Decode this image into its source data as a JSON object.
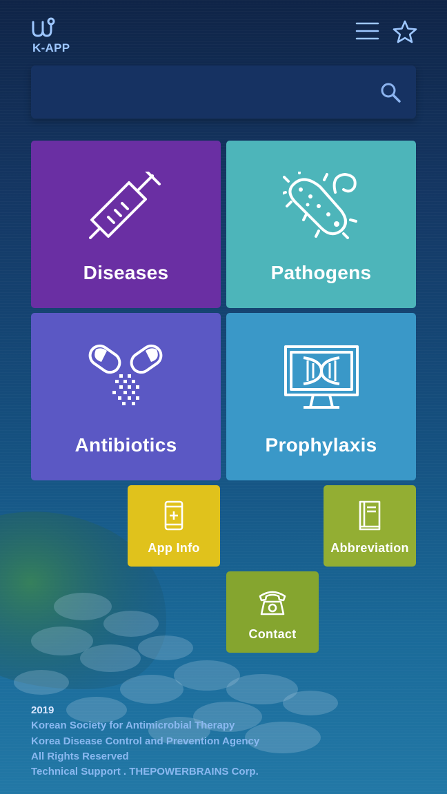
{
  "app": {
    "logo_text": "K-APP"
  },
  "header": {
    "menu_icon": "hamburger-menu-icon",
    "favorite_icon": "star-icon"
  },
  "search": {
    "placeholder": "",
    "value": "",
    "icon": "search-icon"
  },
  "tiles": [
    {
      "label": "Diseases",
      "icon": "syringe-icon",
      "color": "#6a2fa3"
    },
    {
      "label": "Pathogens",
      "icon": "bacteria-icon",
      "color": "#4db5ba"
    },
    {
      "label": "Antibiotics",
      "icon": "pills-icon",
      "color": "#5b58c4"
    },
    {
      "label": "Prophylaxis",
      "icon": "dna-monitor-icon",
      "color": "#3a98c8"
    }
  ],
  "small_tiles": [
    {
      "label": "App Info",
      "icon": "phone-icon",
      "color": "#e0c21c"
    },
    {
      "label": "Abbreviation",
      "icon": "book-icon",
      "color": "#93ae33"
    },
    {
      "label": "Contact",
      "icon": "telephone-icon",
      "color": "#85a52f"
    }
  ],
  "footer": {
    "year": "2019",
    "line1": "Korean Society for Antimicrobial Therapy",
    "line2": "Korea Disease Control and Prevention Agency",
    "line3": "All Rights Reserved",
    "line4": "Technical Support . THEPOWERBRAINS Corp."
  }
}
